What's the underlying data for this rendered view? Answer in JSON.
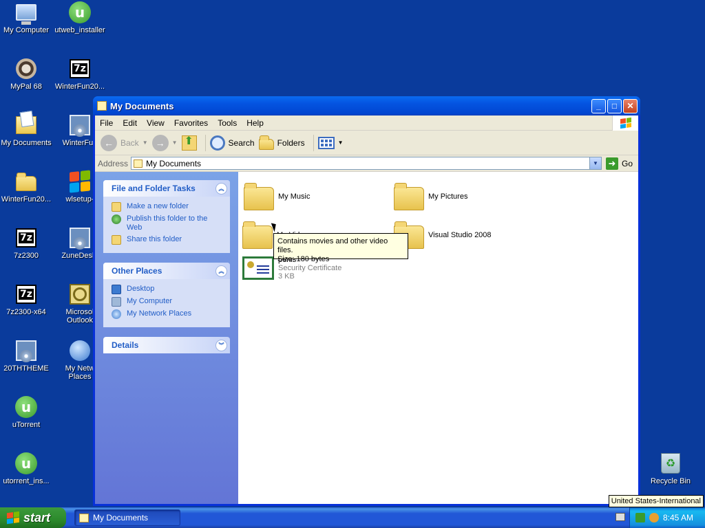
{
  "desktop": {
    "icons": [
      {
        "label": "My Computer"
      },
      {
        "label": "utweb_installer"
      },
      {
        "label": "MyPal 68"
      },
      {
        "label": "WinterFun20..."
      },
      {
        "label": "My Documents"
      },
      {
        "label": "WinterFun"
      },
      {
        "label": "WinterFun20..."
      },
      {
        "label": "wlsetup-"
      },
      {
        "label": "7z2300"
      },
      {
        "label": "ZuneDeskt"
      },
      {
        "label": "7z2300-x64"
      },
      {
        "label": "Microsol Outlook"
      },
      {
        "label": "20THTHEME"
      },
      {
        "label": "My Netw Places"
      },
      {
        "label": "uTorrent"
      },
      {
        "label": "utorrent_ins..."
      },
      {
        "label": "Recycle Bin"
      }
    ],
    "icon_7z_text": "7z",
    "icon_ut_text": "u"
  },
  "window": {
    "title": "My Documents",
    "menu": [
      "File",
      "Edit",
      "View",
      "Favorites",
      "Tools",
      "Help"
    ],
    "toolbar": {
      "back": "Back",
      "search": "Search",
      "folders": "Folders"
    },
    "address": {
      "label": "Address",
      "value": "My Documents",
      "go": "Go"
    },
    "taskpane": {
      "file_tasks": {
        "title": "File and Folder Tasks",
        "links": [
          "Make a new folder",
          "Publish this folder to the Web",
          "Share this folder"
        ]
      },
      "other_places": {
        "title": "Other Places",
        "links": [
          "Desktop",
          "My Computer",
          "My Network Places"
        ]
      },
      "details": {
        "title": "Details"
      }
    },
    "files": [
      {
        "name": "My Music",
        "icon": "music-folder"
      },
      {
        "name": "My Pictures",
        "icon": "pictures-folder"
      },
      {
        "name": "My Videos",
        "icon": "videos-folder"
      },
      {
        "name": "Visual Studio 2008",
        "icon": "folder"
      },
      {
        "name": "penis",
        "type": "Security Certificate",
        "size": "3 KB",
        "icon": "certificate"
      }
    ],
    "tooltip": {
      "line1": "Contains movies and other video files.",
      "line2": "Size: 180 bytes"
    }
  },
  "taskbar": {
    "start": "start",
    "task": "My Documents",
    "clock": "8:45 AM",
    "language_tip": "United States-International"
  },
  "colors": {
    "desktop": "#0a3b9c",
    "link": "#215dc6"
  }
}
